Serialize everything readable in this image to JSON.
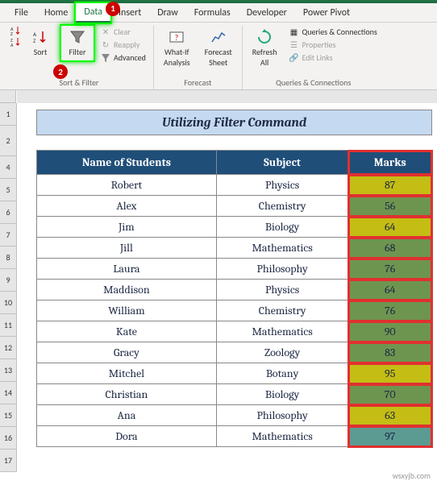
{
  "tabs": [
    "File",
    "Home",
    "Data",
    "Insert",
    "Draw",
    "Formulas",
    "Developer",
    "Power Pivot"
  ],
  "active_tab_index": 2,
  "callouts": {
    "one": "1",
    "two": "2"
  },
  "ribbon": {
    "sort_filter": {
      "sort": "Sort",
      "filter": "Filter",
      "clear": "Clear",
      "reapply": "Reapply",
      "advanced": "Advanced",
      "group_label": "Sort & Filter"
    },
    "forecast": {
      "whatif": "What-If\nAnalysis",
      "sheet": "Forecast\nSheet",
      "group_label": "Forecast"
    },
    "queries": {
      "refresh": "Refresh\nAll",
      "qc": "Queries & Connections",
      "props": "Properties",
      "links": "Edit Links",
      "group_label": "Queries & Connections"
    }
  },
  "title": "Utilizing Filter Command",
  "headers": {
    "name": "Name of Students",
    "subject": "Subject",
    "marks": "Marks"
  },
  "rows": [
    {
      "i": "5",
      "name": "Robert",
      "subject": "Physics",
      "marks": "87",
      "cls": "mark-yellow"
    },
    {
      "i": "6",
      "name": "Alex",
      "subject": "Chemistry",
      "marks": "56",
      "cls": "mark-green"
    },
    {
      "i": "7",
      "name": "Jim",
      "subject": "Biology",
      "marks": "64",
      "cls": "mark-yellow"
    },
    {
      "i": "8",
      "name": "Jill",
      "subject": "Mathematics",
      "marks": "68",
      "cls": "mark-green"
    },
    {
      "i": "9",
      "name": "Laura",
      "subject": "Philosophy",
      "marks": "76",
      "cls": "mark-green"
    },
    {
      "i": "10",
      "name": "Maddison",
      "subject": "Physics",
      "marks": "64",
      "cls": "mark-green"
    },
    {
      "i": "11",
      "name": "William",
      "subject": "Chemistry",
      "marks": "76",
      "cls": "mark-green"
    },
    {
      "i": "12",
      "name": "Kate",
      "subject": "Mathematics",
      "marks": "90",
      "cls": "mark-green"
    },
    {
      "i": "13",
      "name": "Gracy",
      "subject": "Zoology",
      "marks": "83",
      "cls": "mark-green"
    },
    {
      "i": "14",
      "name": "Mitchel",
      "subject": "Botany",
      "marks": "95",
      "cls": "mark-yellow"
    },
    {
      "i": "15",
      "name": "Christian",
      "subject": "Biology",
      "marks": "70",
      "cls": "mark-green"
    },
    {
      "i": "16",
      "name": "Ana",
      "subject": "Philosophy",
      "marks": "63",
      "cls": "mark-yellow"
    },
    {
      "i": "17",
      "name": "Dora",
      "subject": "Mathematics",
      "marks": "97",
      "cls": "mark-teal"
    }
  ],
  "row_header_start": [
    "1",
    "2",
    "4"
  ],
  "watermark": "wsxyjb.com"
}
